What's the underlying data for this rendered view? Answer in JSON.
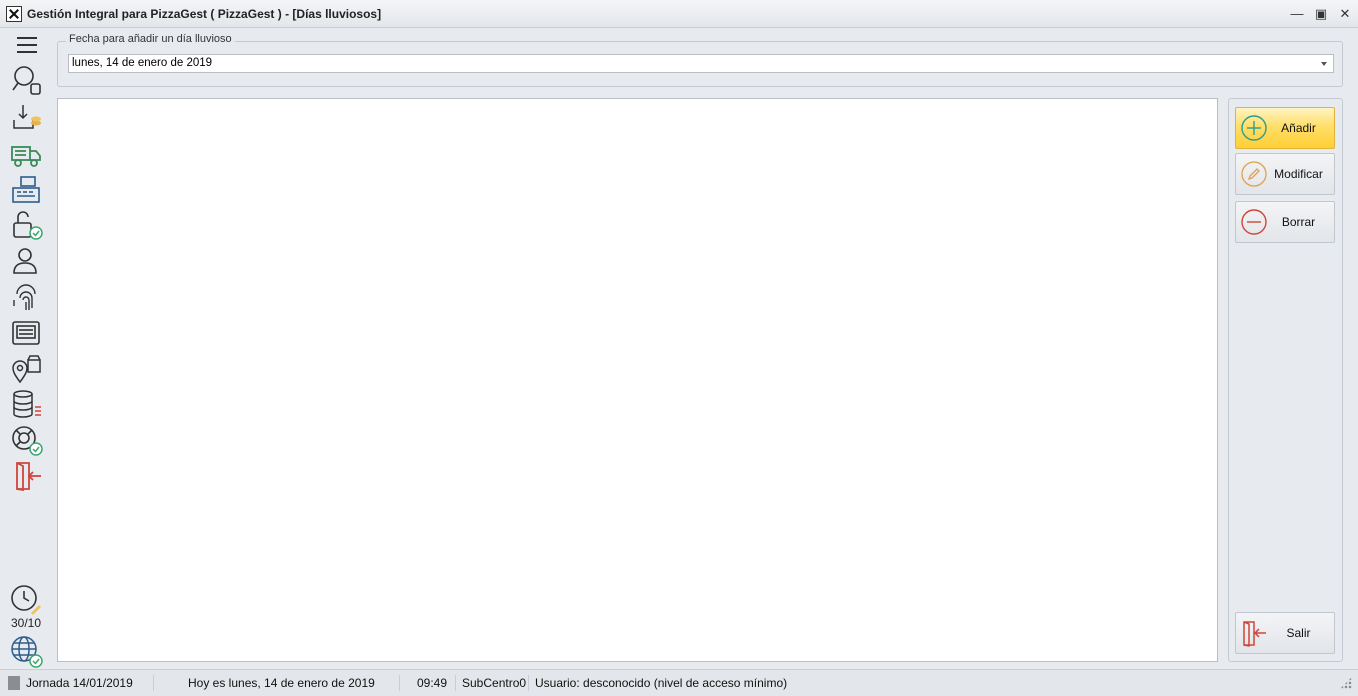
{
  "window": {
    "title": "Gestión Integral para PizzaGest ( PizzaGest ) - [Días lluviosos]",
    "controls": [
      "minimize-icon",
      "maximize-icon",
      "close-icon"
    ]
  },
  "sidebar": {
    "items": [
      {
        "icon": "menu-icon"
      },
      {
        "icon": "search-icon"
      },
      {
        "icon": "inbox-coins-icon"
      },
      {
        "icon": "delivery-truck-icon"
      },
      {
        "icon": "cash-register-icon"
      },
      {
        "icon": "unlock-check-icon"
      },
      {
        "icon": "user-icon"
      },
      {
        "icon": "fingerprint-icon"
      },
      {
        "icon": "keyboard-icon"
      },
      {
        "icon": "store-location-icon"
      },
      {
        "icon": "database-list-icon"
      },
      {
        "icon": "lifebuoy-check-icon"
      },
      {
        "icon": "exit-door-icon"
      }
    ],
    "clock_label": "30/10",
    "bottom_icons": [
      "clock-edit-icon",
      "globe-check-icon"
    ]
  },
  "date_group": {
    "legend": "Fecha para añadir un día lluvioso",
    "value": "lunes, 14 de enero de 2019"
  },
  "actions": {
    "add": "Añadir",
    "modify": "Modificar",
    "delete": "Borrar",
    "exit": "Salir"
  },
  "colors": {
    "add_active": "#ffd84d",
    "add_icon": "#2a9d8f",
    "modify_icon": "#e0a050",
    "delete_icon": "#d0453a",
    "exit_icon": "#d0453a"
  },
  "status": {
    "jornada": "Jornada 14/01/2019",
    "today": "Hoy es lunes, 14 de enero de 2019",
    "time": "09:49",
    "subcentro": "SubCentro0",
    "user": "Usuario: desconocido (nivel de acceso mínimo)"
  }
}
